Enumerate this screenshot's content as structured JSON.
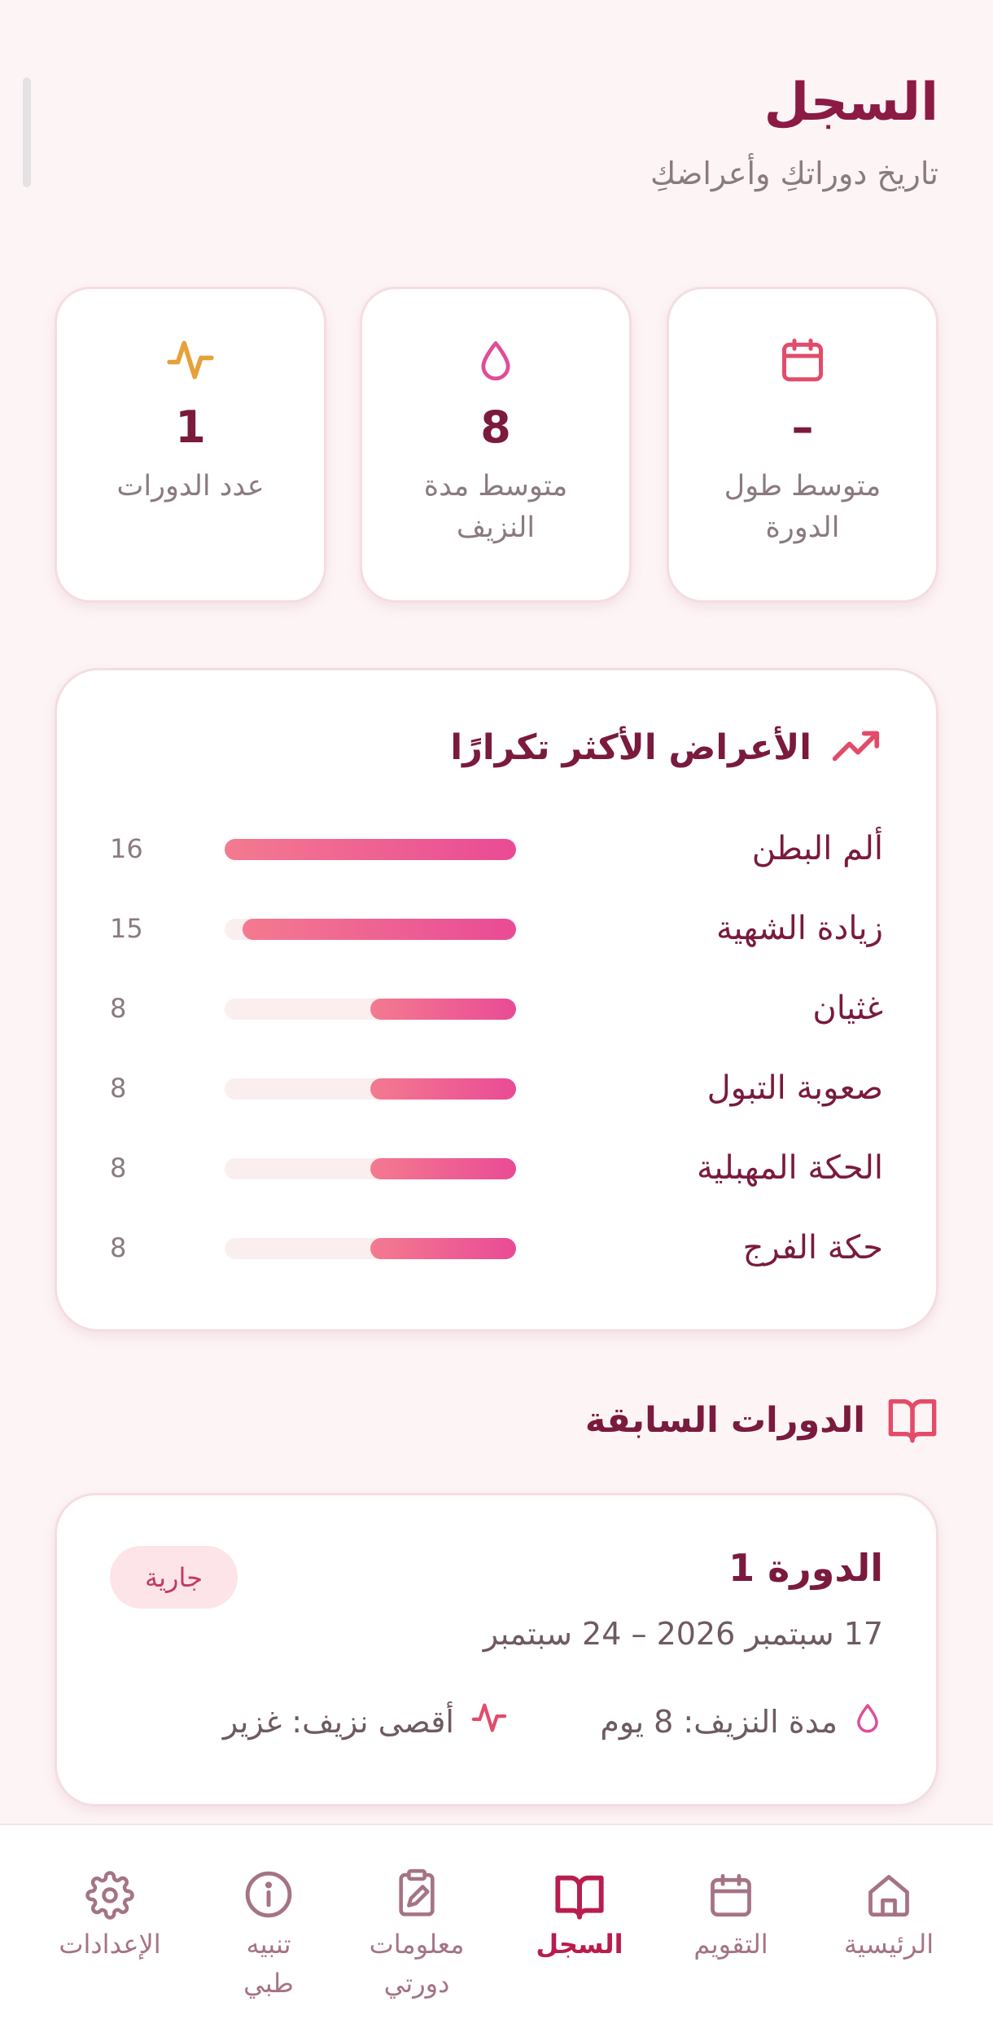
{
  "header": {
    "title": "السجل",
    "subtitle": "تاريخ دوراتكِ وأعراضكِ"
  },
  "stats": [
    {
      "icon": "calendar-icon",
      "value": "–",
      "label": "متوسط طول الدورة"
    },
    {
      "icon": "droplet-icon",
      "value": "8",
      "label": "متوسط مدة النزيف"
    },
    {
      "icon": "activity-icon",
      "value": "1",
      "label": "عدد الدورات"
    }
  ],
  "symptoms": {
    "title": "الأعراض الأكثر تكرارًا",
    "icon": "trending-up-icon",
    "items": [
      {
        "name": "ألم البطن",
        "count": "16",
        "fraction": 1.0
      },
      {
        "name": "زيادة الشهية",
        "count": "15",
        "fraction": 0.9375
      },
      {
        "name": "غثيان",
        "count": "8",
        "fraction": 0.5
      },
      {
        "name": "صعوبة التبول",
        "count": "8",
        "fraction": 0.5
      },
      {
        "name": "الحكة المهبلية",
        "count": "8",
        "fraction": 0.5
      },
      {
        "name": "حكة الفرج",
        "count": "8",
        "fraction": 0.5
      }
    ]
  },
  "previous_cycles": {
    "title": "الدورات السابقة",
    "icon": "book-icon",
    "cycles": [
      {
        "name": "الدورة 1",
        "status": "جارية",
        "dates": "17 سبتمبر 2026 – 24 سبتمبر",
        "bleeding_duration": "مدة النزيف: 8 يوم",
        "max_flow": "أقصى نزيف: غزير"
      }
    ]
  },
  "nav": {
    "items": [
      {
        "label": "الرئيسية",
        "icon": "home-icon",
        "active": false
      },
      {
        "label": "التقويم",
        "icon": "calendar-icon",
        "active": false
      },
      {
        "label": "السجل",
        "icon": "book-icon",
        "active": true
      },
      {
        "label": "معلومات دورتي",
        "icon": "clipboard-edit-icon",
        "active": false
      },
      {
        "label": "تنبيه طبي",
        "icon": "info-icon",
        "active": false
      },
      {
        "label": "الإعدادات",
        "icon": "gear-icon",
        "active": false
      }
    ]
  },
  "colors": {
    "accent": "#b81d4e",
    "title": "#8b1a45",
    "bar_start": "#f47a90",
    "bar_end": "#e94b95",
    "badge_bg": "#fce4e8"
  }
}
